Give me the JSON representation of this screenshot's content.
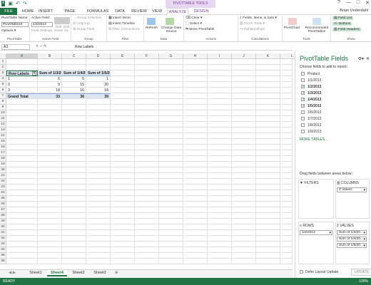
{
  "window": {
    "title": "Products - Excel",
    "context_tools": "PIVOTTABLE TOOLS",
    "user": "Brian Underdahl"
  },
  "tabs": [
    "FILE",
    "HOME",
    "INSERT",
    "PAGE LAYOUT",
    "FORMULAS",
    "DATA",
    "REVIEW",
    "VIEW",
    "ANALYZE",
    "DESIGN"
  ],
  "ribbon": {
    "pivottable_name_label": "PivotTable Name:",
    "pivottable_name": "PivotTable10",
    "options": "Options",
    "group_pivottable": "PivotTable",
    "active_field_label": "Active Field:",
    "active_field": "1/2/2013",
    "field_settings": "Field Settings",
    "drill_down": "Drill Down",
    "drill_up": "Drill Up",
    "group_active_field": "Active Field",
    "group_selection": "Group Selection",
    "ungroup": "Ungroup",
    "group_field": "Group Field",
    "group_group": "Group",
    "insert_slicer": "Insert Slicer",
    "insert_timeline": "Insert Timeline",
    "filter_connections": "Filter Connections",
    "group_filter": "Filter",
    "refresh": "Refresh",
    "change_data_source": "Change Data Source",
    "group_data": "Data",
    "clear": "Clear",
    "select": "Select",
    "move_pivottable": "Move PivotTable",
    "group_actions": "Actions",
    "fields_items_sets": "Fields, Items, & Sets",
    "olap_tools": "OLAP Tools",
    "relationships": "Relationships",
    "group_calculations": "Calculations",
    "pivotchart": "PivotChart",
    "recommended_pivottables": "Recommended PivotTables",
    "group_tools": "Tools",
    "field_list": "Field List",
    "buttons": "+/- Buttons",
    "field_headers": "Field Headers",
    "group_show": "Show"
  },
  "formula_bar": {
    "name_box": "A3",
    "fx": "fx",
    "value": "Row Labels"
  },
  "columns": [
    "A",
    "B",
    "C",
    "D",
    "E",
    "F",
    "G",
    "H",
    "I",
    "J",
    "K",
    "L"
  ],
  "rows": [
    "1",
    "2",
    "3",
    "4",
    "5",
    "6",
    "7",
    "8",
    "9",
    "10",
    "11",
    "12",
    "13",
    "14",
    "15",
    "16",
    "17",
    "18",
    "19",
    "20",
    "21",
    "22",
    "23",
    "24",
    "25",
    "26",
    "27",
    "28",
    "29",
    "30",
    "31",
    "32",
    "33",
    "34",
    "35",
    "36",
    "37",
    "38"
  ],
  "pivot": {
    "headers": [
      "Row Labels",
      "Sum of 1/3/2013",
      "Sum of 1/4/2013",
      "Sum of 1/5/2013"
    ],
    "rows": [
      [
        "1",
        "6",
        "5",
        "1"
      ],
      [
        "2",
        "9",
        "15",
        "20"
      ],
      [
        "3",
        "18",
        "16",
        "18"
      ]
    ],
    "total": [
      "Grand Total",
      "33",
      "36",
      "39"
    ]
  },
  "sheet_tabs": [
    "Sheet1",
    "Sheet4",
    "Sheet2",
    "Sheet3"
  ],
  "active_sheet": "Sheet4",
  "status": "READY",
  "zoom": "100%",
  "panel": {
    "title": "PivotTable Fields",
    "subtitle": "Choose fields to add to report:",
    "fields": [
      {
        "name": "Product",
        "checked": false
      },
      {
        "name": "1/1/2013",
        "checked": false
      },
      {
        "name": "1/2/2013",
        "checked": true
      },
      {
        "name": "1/3/2013",
        "checked": true
      },
      {
        "name": "1/4/2013",
        "checked": true
      },
      {
        "name": "1/5/2013",
        "checked": true
      },
      {
        "name": "1/6/2013",
        "checked": false
      },
      {
        "name": "1/7/2013",
        "checked": false
      },
      {
        "name": "1/8/2013",
        "checked": false
      },
      {
        "name": "1/9/2013",
        "checked": false
      }
    ],
    "more_tables": "MORE TABLES...",
    "drag_text": "Drag fields between areas below:",
    "filters_label": "FILTERS",
    "columns_label": "COLUMNS",
    "rows_label": "ROWS",
    "values_label": "VALUES",
    "columns_item": "Σ Values",
    "rows_item": "1/2/2013",
    "values_items": [
      "Sum of 1/3/20...",
      "Sum of 1/4/20...",
      "Sum of 1/5/20..."
    ],
    "defer_label": "Defer Layout Update",
    "update_button": "UPDATE"
  }
}
